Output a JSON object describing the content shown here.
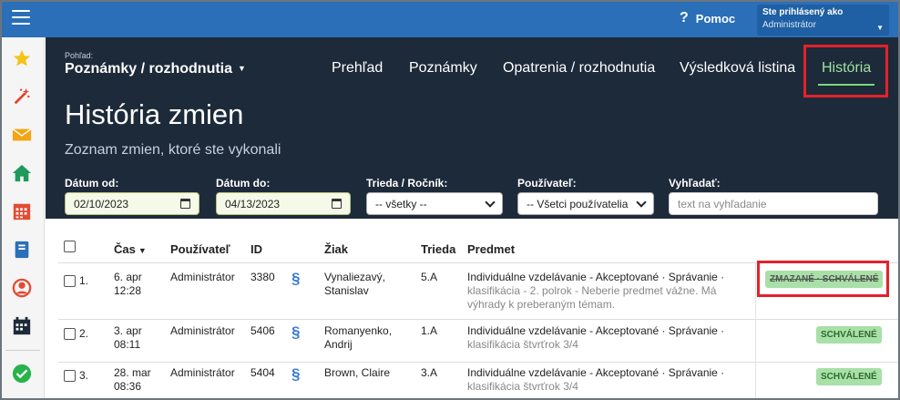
{
  "topbar": {
    "help_label": "Pomoc",
    "user_line1": "Ste prihlásený ako",
    "user_line2": "Administrátor"
  },
  "header": {
    "view_label": "Pohľad:",
    "view_name": "Poznámky / rozhodnutia",
    "nav": [
      "Prehľad",
      "Poznámky",
      "Opatrenia / rozhodnutia",
      "Výsledková listina",
      "História"
    ],
    "active_nav": "História",
    "title": "História zmien",
    "subtitle": "Zoznam zmien, ktoré ste vykonali"
  },
  "filters": {
    "date_from_label": "Dátum od:",
    "date_from": "02/10/2023",
    "date_to_label": "Dátum do:",
    "date_to": "04/13/2023",
    "class_label": "Trieda / Ročník:",
    "class_value": "-- všetky --",
    "user_label": "Používateľ:",
    "user_value": "-- Všetci používatelia",
    "search_label": "Vyhľadať:",
    "search_placeholder": "text na vyhľadanie"
  },
  "table": {
    "columns": [
      "Čas",
      "Používateľ",
      "ID",
      "Žiak",
      "Trieda",
      "Predmet"
    ],
    "rows": [
      {
        "num": "1.",
        "time1": "6. apr",
        "time2": "12:28",
        "user": "Administrátor",
        "id": "3380",
        "student1": "Vynaliezavý,",
        "student2": "Stanislav",
        "class": "5.A",
        "subject_main": "Individuálne vzdelávanie - Akceptované · Správanie ·",
        "subject_sub1": "klasifikácia - 2. polrok - Neberie predmet vážne. Má",
        "subject_sub2": "výhrady k preberaným témam.",
        "badge": "ZMAZANÉ · SCHVÁLENÉ"
      },
      {
        "num": "2.",
        "time1": "3. apr",
        "time2": "08:11",
        "user": "Administrátor",
        "id": "5406",
        "student1": "Romanyenko,",
        "student2": "Andrij",
        "class": "1.A",
        "subject_main": "Individuálne vzdelávanie - Akceptované · Správanie ·",
        "subject_sub1": "klasifikácia štvrťrok 3/4",
        "subject_sub2": "",
        "badge": "SCHVÁLENÉ"
      },
      {
        "num": "3.",
        "time1": "28. mar",
        "time2": "08:36",
        "user": "Administrátor",
        "id": "5404",
        "student1": "Brown, Claire",
        "student2": "",
        "class": "3.A",
        "subject_main": "Individuálne vzdelávanie - Akceptované · Správanie ·",
        "subject_sub1": "klasifikácia štvrťrok 3/4",
        "subject_sub2": "",
        "badge": "SCHVÁLENÉ"
      }
    ]
  },
  "icons": {
    "paragraph": "§"
  }
}
